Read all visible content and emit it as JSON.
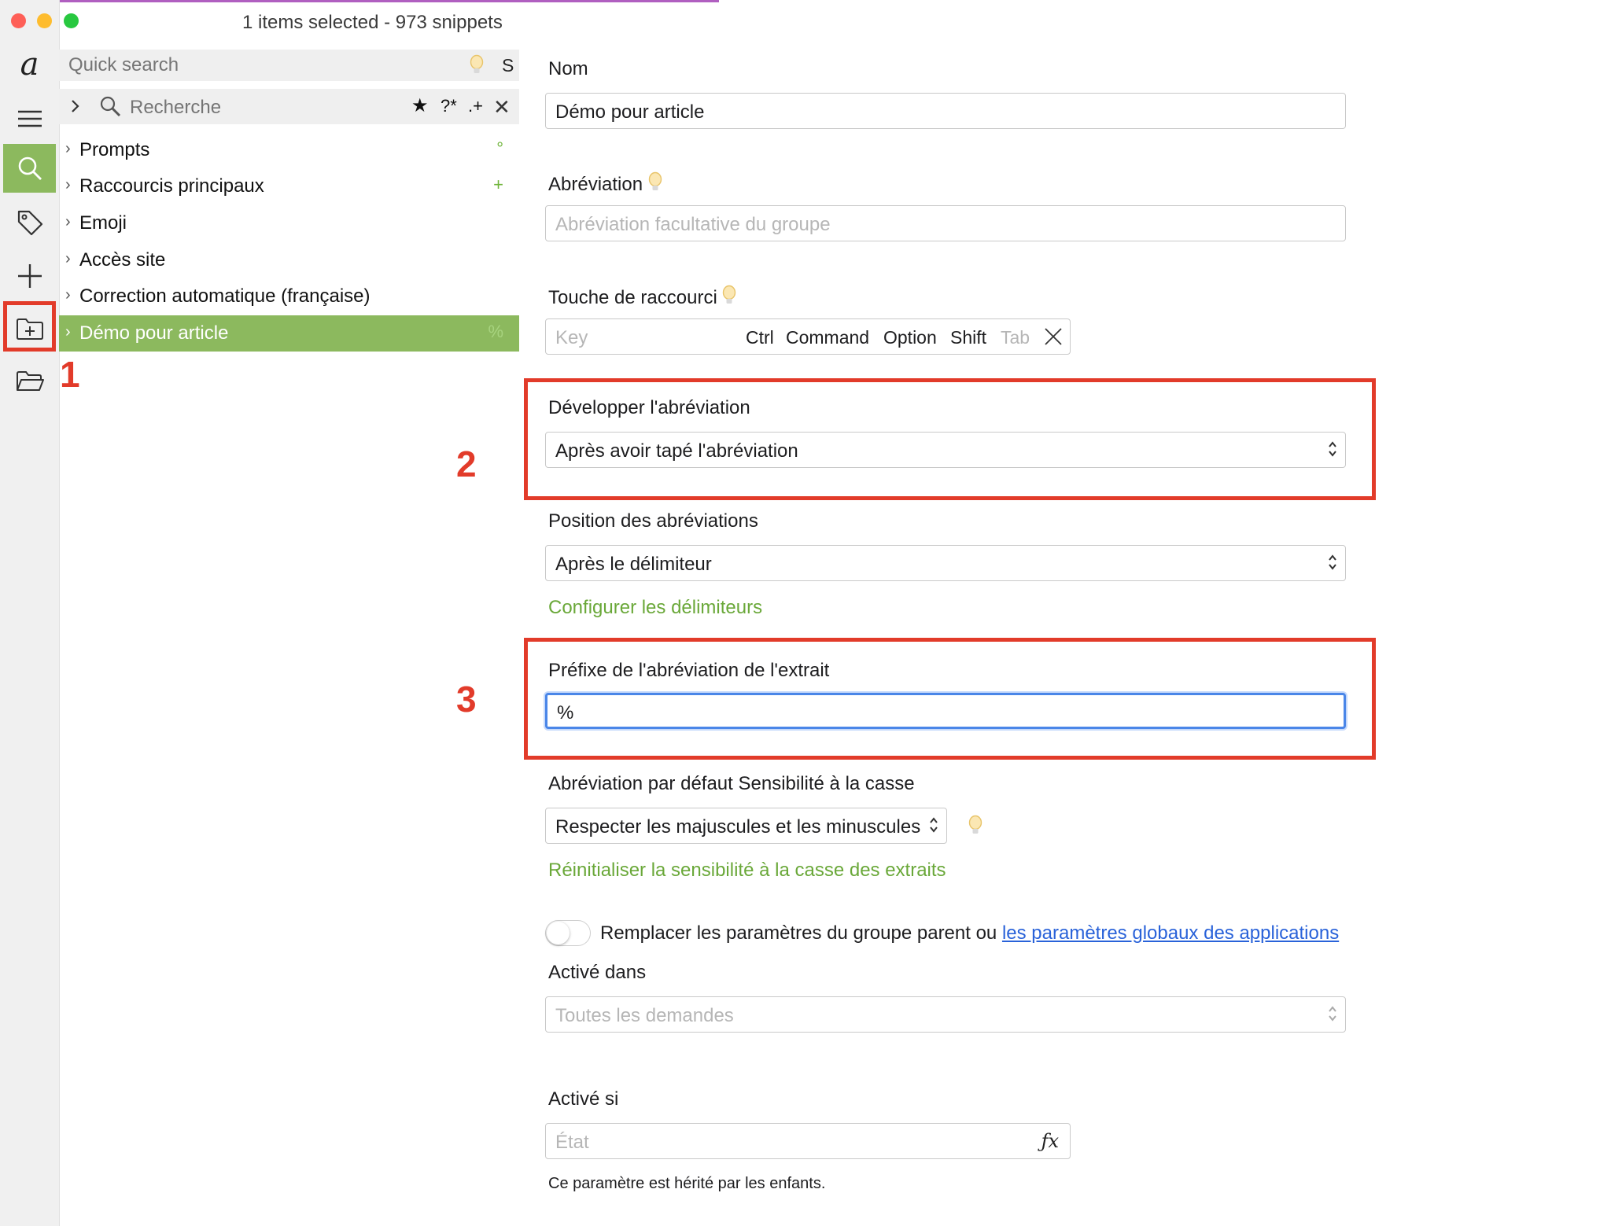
{
  "window": {
    "title": "1 items selected - 973 snippets"
  },
  "colors": {
    "accent_green": "#8cb95e",
    "link_green": "#6aa839",
    "link_blue": "#2962d9",
    "annotation_red": "#e23b2a"
  },
  "toolbar": {
    "icons": [
      "app-logo-icon",
      "menu-icon",
      "search-icon",
      "tag-icon",
      "plus-icon",
      "new-folder-icon",
      "folder-open-icon"
    ],
    "logo_glyph": "a"
  },
  "annotations": [
    "1",
    "2",
    "3"
  ],
  "sidebar": {
    "quick_search_placeholder": "Quick search",
    "quick_search_shortcut": "S",
    "search_placeholder": "Recherche",
    "search_buttons": {
      "star": "★",
      "regex": "?*",
      "plus": ".+",
      "close": "✕"
    },
    "items": [
      {
        "label": "Prompts",
        "badge": "°"
      },
      {
        "label": "Raccourcis principaux",
        "badge": "+"
      },
      {
        "label": "Emoji",
        "badge": ""
      },
      {
        "label": "Accès site",
        "badge": ""
      },
      {
        "label": "Correction automatique (française)",
        "badge": ""
      },
      {
        "label": "Démo pour article",
        "badge": "%"
      }
    ],
    "selected_index": 5
  },
  "form": {
    "name_label": "Nom",
    "name_value": "Démo pour article",
    "abbrev_label": "Abréviation",
    "abbrev_placeholder": "Abréviation facultative du groupe",
    "shortcut_label": "Touche de raccourci",
    "shortcut_key_placeholder": "Key",
    "modifiers": {
      "ctrl": "Ctrl",
      "command": "Command",
      "option": "Option",
      "shift": "Shift",
      "tab": "Tab"
    },
    "expand_label": "Développer l'abréviation",
    "expand_value": "Après avoir tapé l'abréviation",
    "position_label": "Position des abréviations",
    "position_value": "Après le délimiteur",
    "configure_delims_link": "Configurer les délimiteurs",
    "prefix_label": "Préfixe de l'abréviation de l'extrait",
    "prefix_value": "%",
    "case_label": "Abréviation par défaut Sensibilité à la casse",
    "case_value": "Respecter les majuscules et les minuscules",
    "reset_case_link": "Réinitialiser la sensibilité à la casse des extraits",
    "override_text": "Remplacer les paramètres du groupe parent ou",
    "override_link": "les paramètres globaux des applications",
    "override_toggle_on": false,
    "enabled_in_label": "Activé dans",
    "enabled_in_value": "Toutes les demandes",
    "enabled_if_label": "Activé si",
    "condition_placeholder": "État",
    "fx_label": "ƒx",
    "inherit_hint": "Ce paramètre est hérité par les enfants."
  }
}
